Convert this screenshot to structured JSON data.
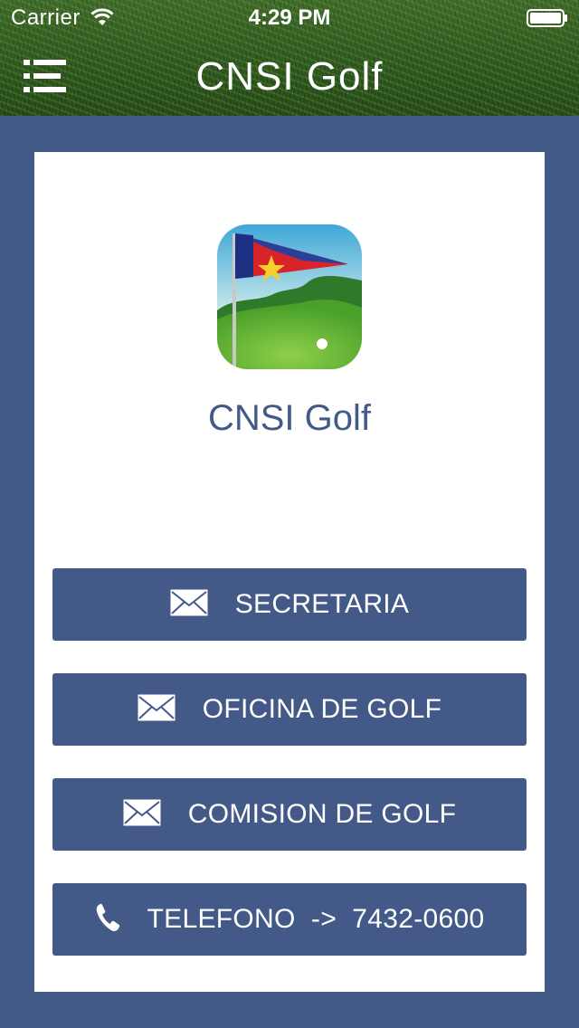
{
  "status_bar": {
    "carrier": "Carrier",
    "time": "4:29 PM"
  },
  "header": {
    "title": "CNSI Golf",
    "menu_icon": "menu-list-icon"
  },
  "card": {
    "club_name": "CNSI Golf",
    "logo_icon": "golf-flag-logo-icon"
  },
  "buttons": [
    {
      "label": "SECRETARIA",
      "icon": "envelope-icon"
    },
    {
      "label": "OFICINA DE GOLF",
      "icon": "envelope-icon"
    },
    {
      "label": "COMISION DE GOLF",
      "icon": "envelope-icon"
    },
    {
      "label": "TELEFONO  ->  7432-0600",
      "icon": "phone-icon"
    }
  ],
  "colors": {
    "primary": "#435a89",
    "card": "#ffffff",
    "header_grass": "#2f5a1f"
  }
}
